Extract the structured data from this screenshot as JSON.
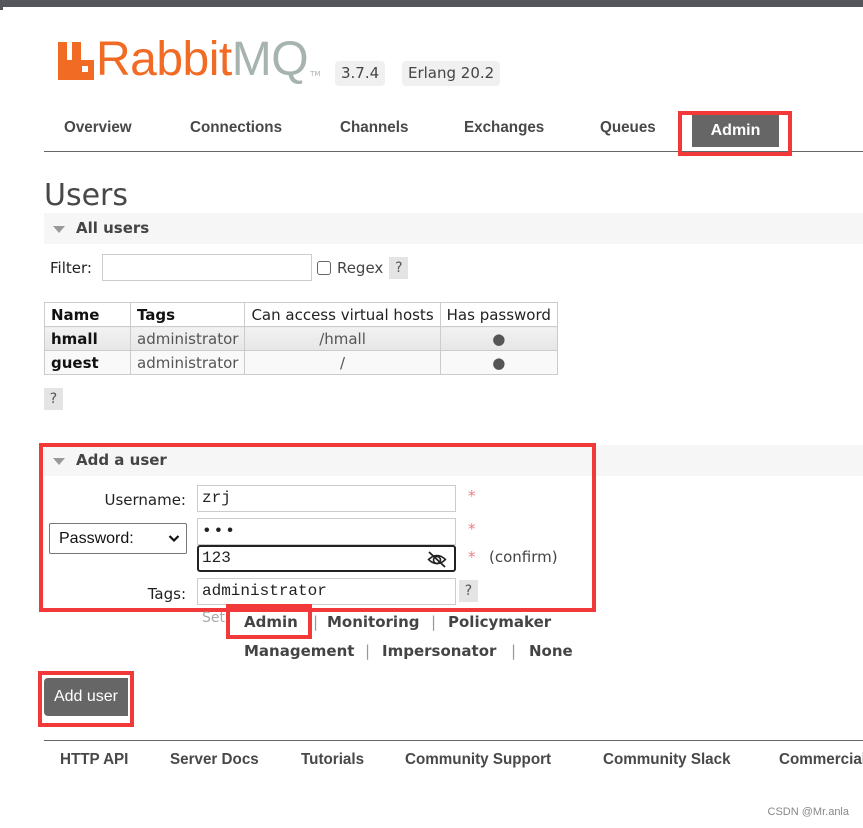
{
  "header": {
    "logo_rabbit": "Rabbit",
    "logo_mq": "MQ",
    "logo_tm": "TM",
    "version": "3.7.4",
    "erlang": "Erlang 20.2"
  },
  "nav": {
    "items": [
      "Overview",
      "Connections",
      "Channels",
      "Exchanges",
      "Queues"
    ],
    "active": "Admin"
  },
  "page": {
    "title": "Users"
  },
  "all_users": {
    "heading": "All users",
    "filter_label": "Filter:",
    "filter_value": "",
    "regex_label": "Regex",
    "help": "?",
    "table": {
      "headers": [
        "Name",
        "Tags",
        "Can access virtual hosts",
        "Has password"
      ],
      "rows": [
        {
          "name": "hmall",
          "tags": "administrator",
          "vhosts": "/hmall",
          "has_password": "●"
        },
        {
          "name": "guest",
          "tags": "administrator",
          "vhosts": "/",
          "has_password": "●"
        }
      ]
    }
  },
  "add_user": {
    "heading": "Add a user",
    "username_label": "Username:",
    "username_value": "zrj",
    "password_mode": "Password:",
    "password_value": "•••",
    "confirm_value": "123",
    "confirm_label": "(confirm)",
    "required_mark": "*",
    "tags_label": "Tags:",
    "tags_value": "administrator",
    "set_label": "Set",
    "tag_options": [
      "Admin",
      "Monitoring",
      "Policymaker",
      "Management",
      "Impersonator",
      "None"
    ],
    "separator": "|",
    "submit": "Add user"
  },
  "footer": {
    "links": [
      "HTTP API",
      "Server Docs",
      "Tutorials",
      "Community Support",
      "Community Slack",
      "Commercial Support"
    ]
  },
  "watermark": "CSDN @Mr.anla",
  "colors": {
    "brand_orange": "#f26b24",
    "brand_grey": "#a6b3ae",
    "active_tab": "#666666",
    "highlight": "#f1393a"
  }
}
